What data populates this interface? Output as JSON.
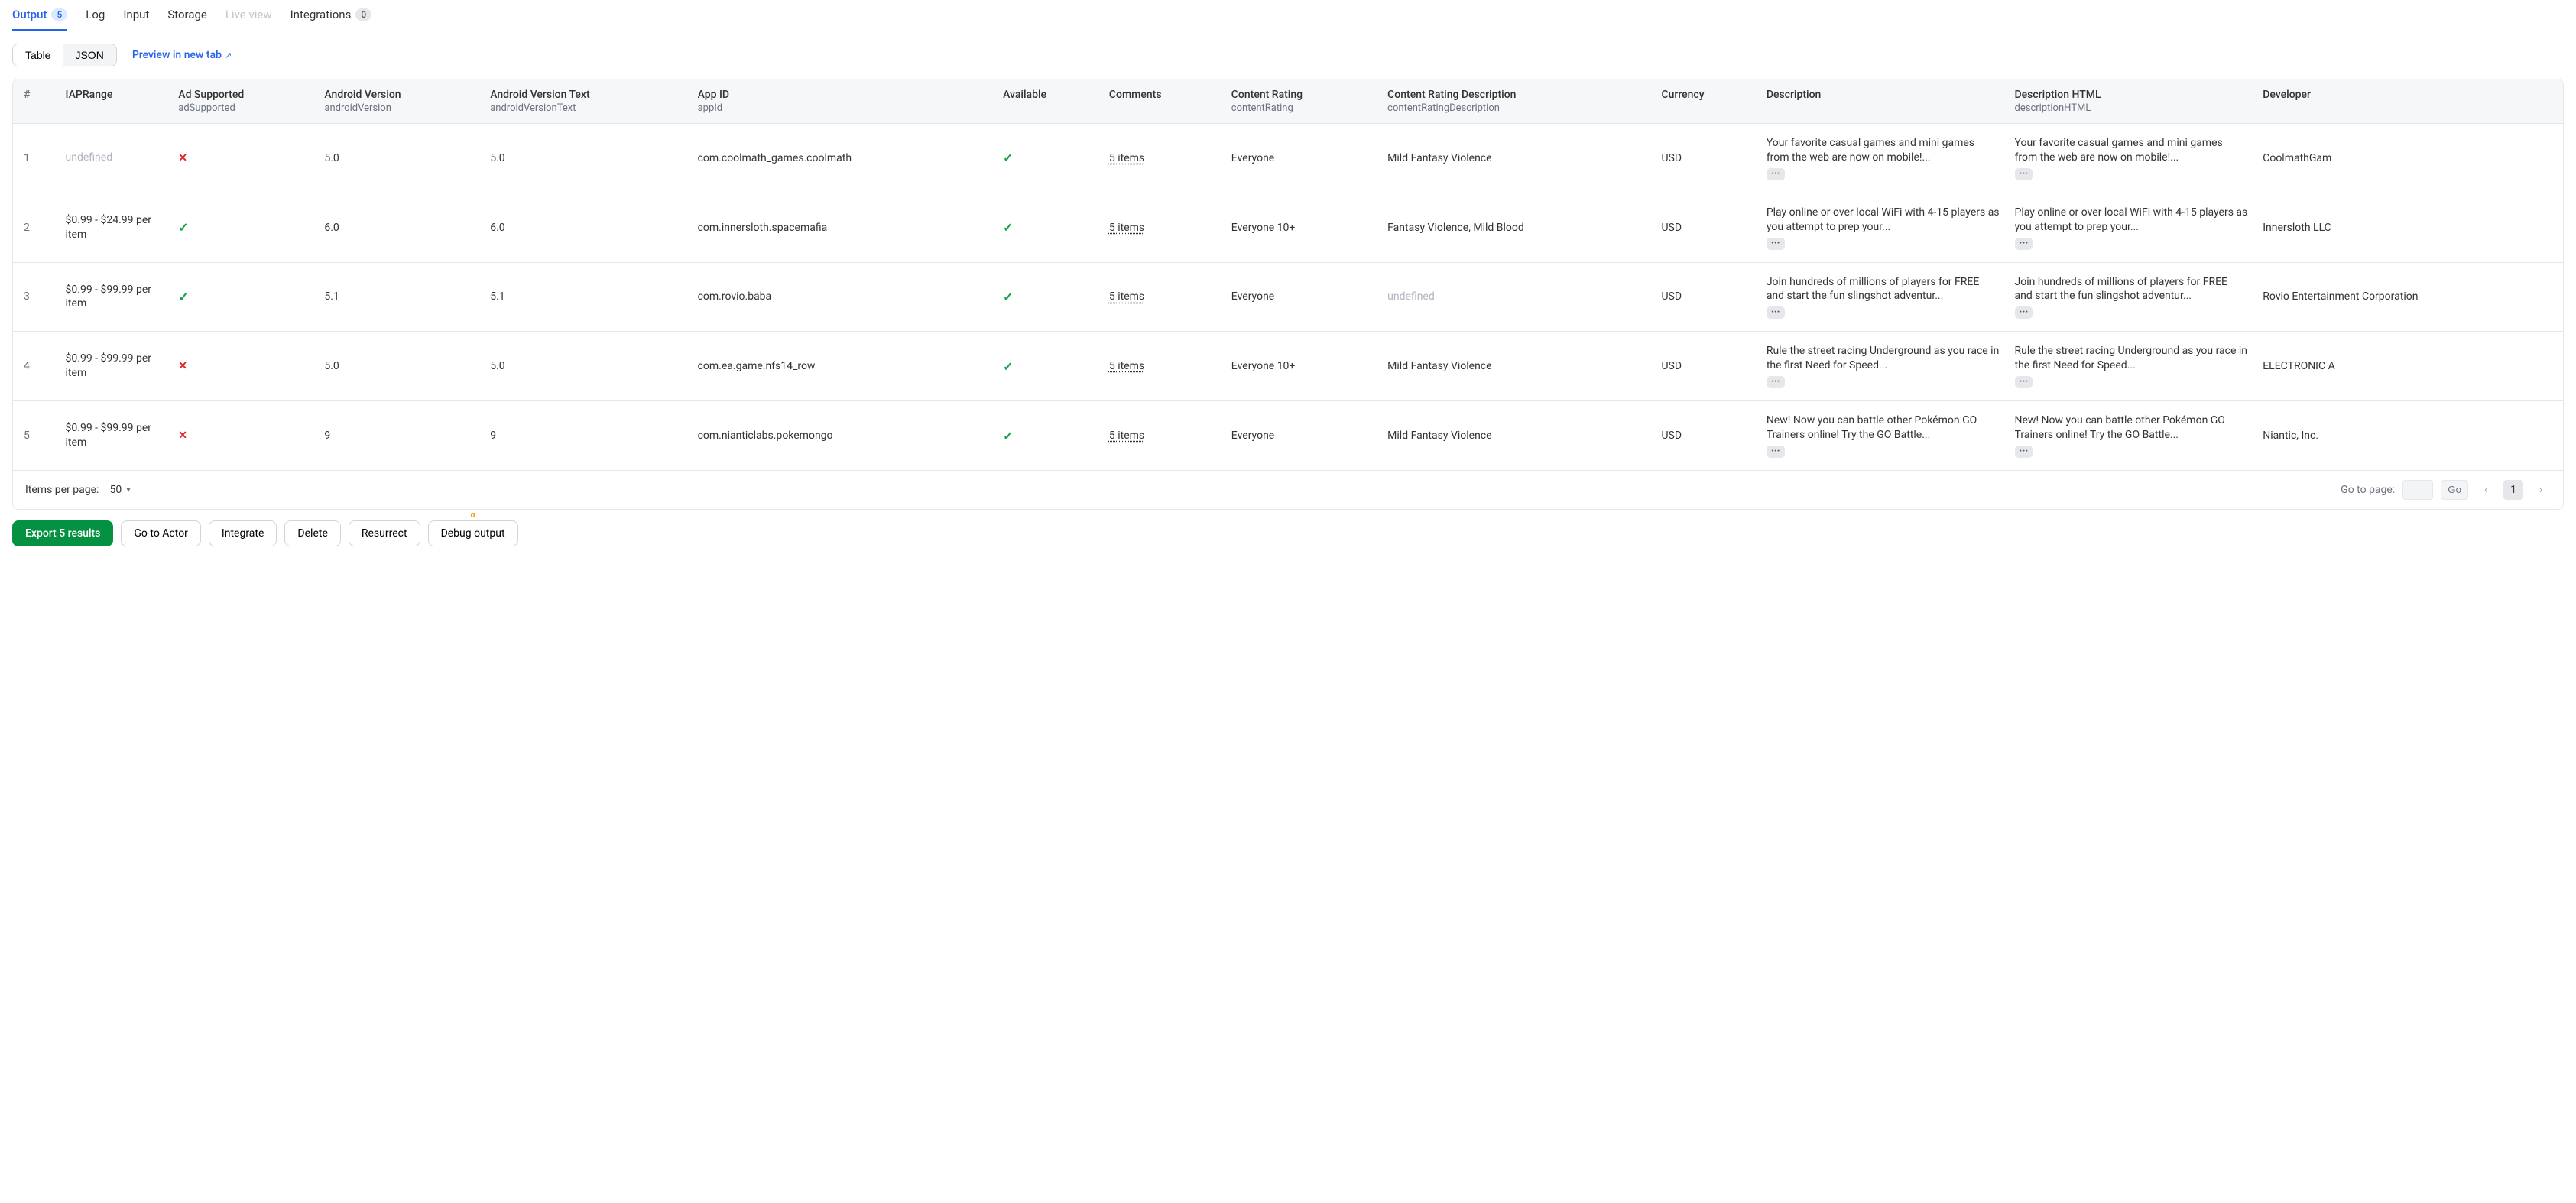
{
  "tabs": [
    {
      "label": "Output",
      "badge": "5",
      "active": true
    },
    {
      "label": "Log"
    },
    {
      "label": "Input"
    },
    {
      "label": "Storage"
    },
    {
      "label": "Live view",
      "disabled": true
    },
    {
      "label": "Integrations",
      "badge": "0"
    }
  ],
  "viewModes": {
    "table": "Table",
    "json": "JSON"
  },
  "previewLink": "Preview in new tab",
  "columns": [
    {
      "label": "#"
    },
    {
      "label": "IAPRange"
    },
    {
      "label": "Ad Supported",
      "key": "adSupported"
    },
    {
      "label": "Android Version",
      "key": "androidVersion"
    },
    {
      "label": "Android Version Text",
      "key": "androidVersionText"
    },
    {
      "label": "App ID",
      "key": "appId"
    },
    {
      "label": "Available"
    },
    {
      "label": "Comments"
    },
    {
      "label": "Content Rating",
      "key": "contentRating"
    },
    {
      "label": "Content Rating Description",
      "key": "contentRatingDescription"
    },
    {
      "label": "Currency"
    },
    {
      "label": "Description"
    },
    {
      "label": "Description HTML",
      "key": "descriptionHTML"
    },
    {
      "label": "Developer"
    }
  ],
  "rows": [
    {
      "idx": "1",
      "iapRange": "undefined",
      "iapUndefined": true,
      "adSupported": false,
      "androidVersion": "5.0",
      "androidVersionText": "5.0",
      "appId": "com.coolmath_games.coolmath",
      "available": true,
      "comments": "5 items",
      "contentRating": "Everyone",
      "contentRatingDescription": "Mild Fantasy Violence",
      "currency": "USD",
      "description": "Your favorite casual games and mini games from the web are now on mobile!...",
      "descriptionHTML": "Your favorite casual games and mini games from the web are now on mobile!...",
      "developer": "CoolmathGam"
    },
    {
      "idx": "2",
      "iapRange": "$0.99 - $24.99 per item",
      "adSupported": true,
      "androidVersion": "6.0",
      "androidVersionText": "6.0",
      "appId": "com.innersloth.spacemafia",
      "available": true,
      "comments": "5 items",
      "contentRating": "Everyone 10+",
      "contentRatingDescription": "Fantasy Violence, Mild Blood",
      "currency": "USD",
      "description": "Play online or over local WiFi with 4-15 players as you attempt to prep your...",
      "descriptionHTML": "Play online or over local WiFi with 4-15 players as you attempt to prep your...",
      "developer": "Innersloth LLC"
    },
    {
      "idx": "3",
      "iapRange": "$0.99 - $99.99 per item",
      "adSupported": true,
      "androidVersion": "5.1",
      "androidVersionText": "5.1",
      "appId": "com.rovio.baba",
      "available": true,
      "comments": "5 items",
      "contentRating": "Everyone",
      "contentRatingDescription": "undefined",
      "crdUndefined": true,
      "currency": "USD",
      "description": "Join hundreds of millions of players for FREE and start the fun slingshot adventur...",
      "descriptionHTML": "Join hundreds of millions of players for FREE and start the fun slingshot adventur...",
      "developer": "Rovio Entertainment Corporation"
    },
    {
      "idx": "4",
      "iapRange": "$0.99 - $99.99 per item",
      "adSupported": false,
      "androidVersion": "5.0",
      "androidVersionText": "5.0",
      "appId": "com.ea.game.nfs14_row",
      "available": true,
      "comments": "5 items",
      "contentRating": "Everyone 10+",
      "contentRatingDescription": "Mild Fantasy Violence",
      "currency": "USD",
      "description": "Rule the street racing Underground as you race in the first Need for Speed...",
      "descriptionHTML": "Rule the street racing Underground as you race in the first Need for Speed...",
      "developer": "ELECTRONIC A"
    },
    {
      "idx": "5",
      "iapRange": "$0.99 - $99.99 per item",
      "adSupported": false,
      "androidVersion": "9",
      "androidVersionText": "9",
      "appId": "com.nianticlabs.pokemongo",
      "available": true,
      "comments": "5 items",
      "contentRating": "Everyone",
      "contentRatingDescription": "Mild Fantasy Violence",
      "currency": "USD",
      "description": "New! Now you can battle other Pokémon GO Trainers online! Try the GO Battle...",
      "descriptionHTML": "New! Now you can battle other Pokémon GO Trainers online! Try the GO Battle...",
      "developer": "Niantic, Inc."
    }
  ],
  "footer": {
    "itemsPerPageLabel": "Items per page:",
    "itemsPerPageValue": "50",
    "goToPageLabel": "Go to page:",
    "goLabel": "Go",
    "currentPage": "1"
  },
  "actions": {
    "export": "Export 5 results",
    "goToActor": "Go to Actor",
    "integrate": "Integrate",
    "delete": "Delete",
    "resurrect": "Resurrect",
    "debug": "Debug output",
    "alpha": "α"
  }
}
